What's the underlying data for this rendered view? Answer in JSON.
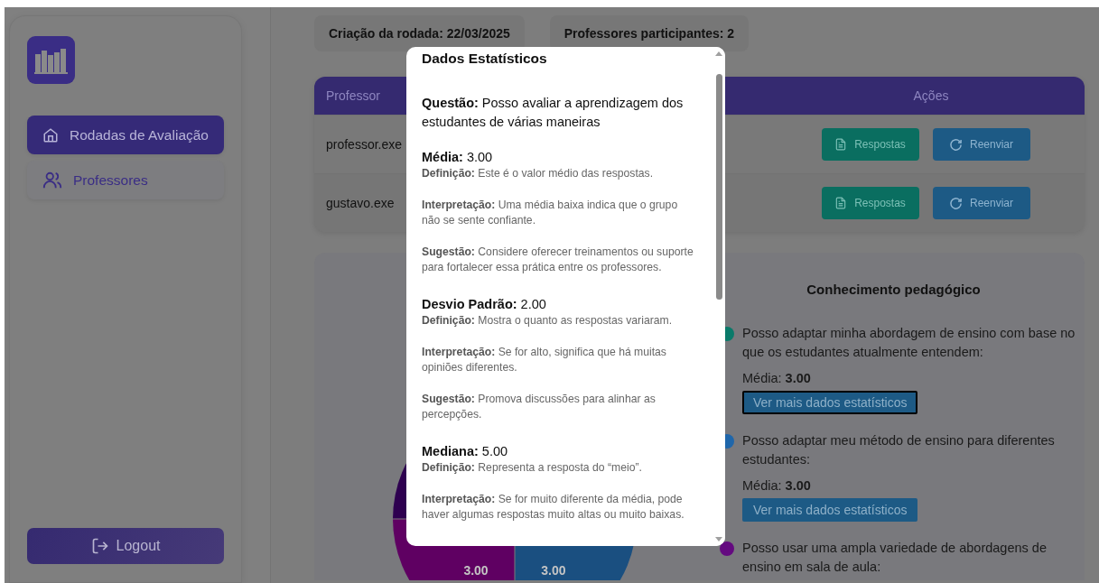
{
  "sidebar": {
    "items": [
      {
        "label": "Rodadas de Avaliação",
        "selected": true
      },
      {
        "label": "Professores",
        "selected": false
      }
    ],
    "logout": "Logout"
  },
  "info": [
    "Criação da rodada: 22/03/2025",
    "Professores participantes: 2"
  ],
  "table": {
    "columns": [
      "Professor",
      "Ações"
    ],
    "rows": [
      {
        "professor": "professor.exe",
        "actions": [
          "Respostas",
          "Reenviar"
        ]
      },
      {
        "professor": "gustavo.exe",
        "actions": [
          "Respostas",
          "Reenviar"
        ]
      }
    ]
  },
  "chart": {
    "title": "Conhecimento pedagógico",
    "slices": [
      {
        "color": "#2e0050"
      },
      {
        "color": "#5f0062",
        "label": "3.00"
      },
      {
        "color": "#1a4f80",
        "label": "3.00"
      }
    ],
    "items": [
      {
        "text": "Posso adaptar minha abordagem de ensino com base no que os estudantes atualmente entendem:",
        "color": "#0a7a6a",
        "mean": "Média: **3.00**",
        "button": "Ver mais dados estatísticos",
        "focused": true
      },
      {
        "text": "Posso adaptar meu método de ensino para diferentes estudantes:",
        "color": "#1f66aa",
        "mean": "Média: **3.00**",
        "button": "Ver mais dados estatísticos",
        "focused": false
      },
      {
        "text": "Posso usar uma ampla variedade de abordagens de ensino em sala de aula:",
        "color": "#640a80"
      }
    ]
  },
  "modal": {
    "title": "Dados Estatísticos",
    "question": "**Questão:** Posso avaliar a aprendizagem dos estudantes de várias maneiras",
    "stats": [
      {
        "head": "**Média:** 3.00",
        "notes": [
          "**Definição:** Este é o valor médio das respostas.",
          "**Interpretação:** Uma média baixa indica que o grupo não se sente confiante.",
          "**Sugestão:** Considere oferecer treinamentos ou suporte para fortalecer essa prática entre os professores."
        ]
      },
      {
        "head": "**Desvio Padrão:** 2.00",
        "notes": [
          "**Definição:** Mostra o quanto as respostas variaram.",
          "**Interpretação:** Se for alto, significa que há muitas opiniões diferentes.",
          "**Sugestão:** Promova discussões para alinhar as percepções."
        ]
      },
      {
        "head": "**Mediana:** 5.00",
        "notes": [
          "**Definição:** Representa a resposta do “meio”.",
          "**Interpretação:** Se for muito diferente da média, pode haver algumas respostas muito altas ou muito baixas."
        ]
      }
    ]
  }
}
